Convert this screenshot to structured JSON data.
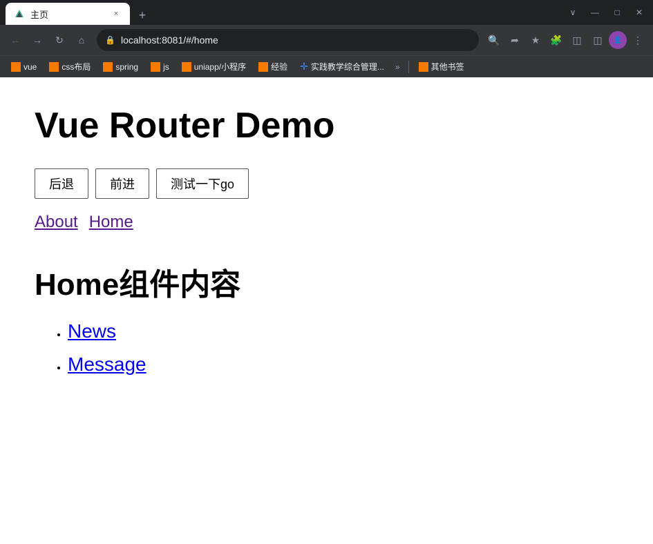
{
  "browser": {
    "tab": {
      "title": "主页",
      "close_label": "×",
      "new_tab_label": "+"
    },
    "window_controls": {
      "minimize": "—",
      "maximize": "□",
      "close": "✕",
      "chevron_down": "∨"
    },
    "nav": {
      "back_label": "←",
      "forward_label": "→",
      "reload_label": "↻",
      "home_label": "⌂",
      "address": "localhost:8081/#/home",
      "zoom_label": "🔍",
      "share_label": "⎙",
      "bookmark_label": "☆",
      "puzzle_label": "🧩",
      "menu_label": "⋮"
    },
    "bookmarks": [
      {
        "id": "vue",
        "label": "vue",
        "color": "orange"
      },
      {
        "id": "css",
        "label": "css布局",
        "color": "orange"
      },
      {
        "id": "spring",
        "label": "spring",
        "color": "orange"
      },
      {
        "id": "js",
        "label": "js",
        "color": "orange"
      },
      {
        "id": "uniapp",
        "label": "uniapp/小程序",
        "color": "orange"
      },
      {
        "id": "jingyan",
        "label": "经验",
        "color": "orange"
      },
      {
        "id": "shijian",
        "label": "实践教学综合管理...",
        "color": "teal"
      }
    ],
    "bookmarks_more_label": "»",
    "bookmarks_other_label": "其他书签"
  },
  "page": {
    "main_title": "Vue Router Demo",
    "buttons": {
      "back": "后退",
      "forward": "前进",
      "go": "测试一下go"
    },
    "router_links": [
      {
        "id": "about",
        "label": "About"
      },
      {
        "id": "home",
        "label": "Home"
      }
    ],
    "section_title": "Home组件内容",
    "nav_items": [
      {
        "id": "news",
        "label": "News"
      },
      {
        "id": "message",
        "label": "Message"
      }
    ]
  }
}
